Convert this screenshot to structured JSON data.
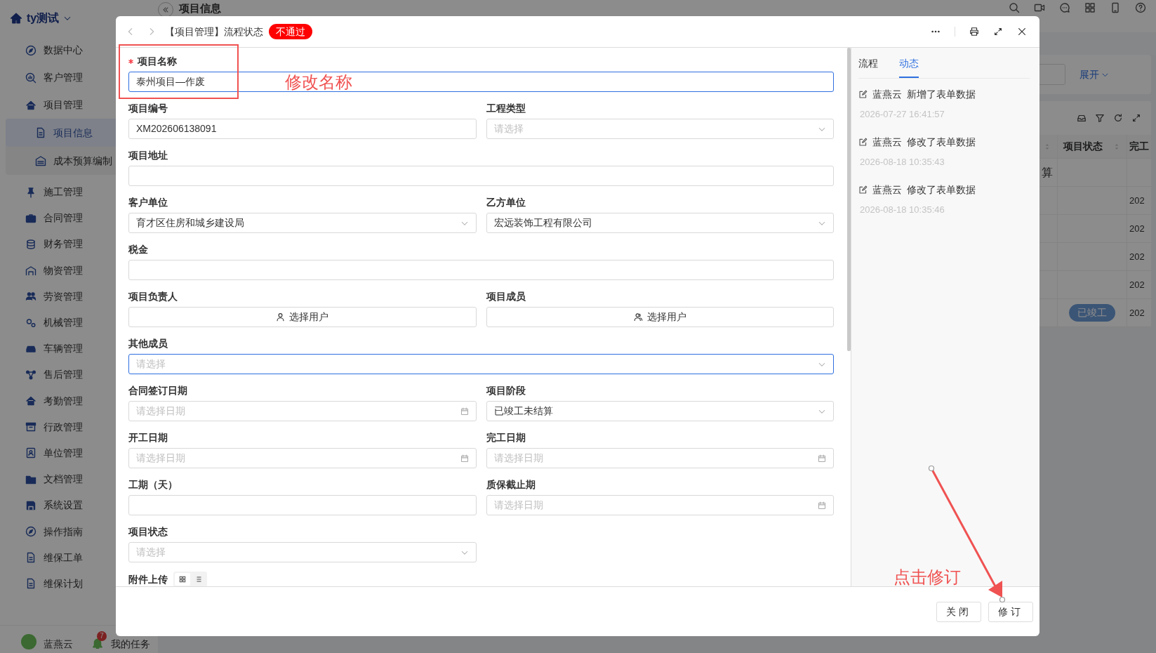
{
  "sidebar": {
    "brand": "ty测试",
    "items": [
      {
        "label": "数据中心",
        "selected": false
      },
      {
        "label": "客户管理",
        "selected": false
      },
      {
        "label": "项目管理",
        "selected": false,
        "children": [
          {
            "label": "项目信息",
            "selected": true
          },
          {
            "label": "成本预算编制",
            "selected": false
          }
        ]
      },
      {
        "label": "施工管理",
        "selected": false
      },
      {
        "label": "合同管理",
        "selected": false
      },
      {
        "label": "财务管理",
        "selected": false
      },
      {
        "label": "物资管理",
        "selected": false
      },
      {
        "label": "劳资管理",
        "selected": false
      },
      {
        "label": "机械管理",
        "selected": false
      },
      {
        "label": "车辆管理",
        "selected": false
      },
      {
        "label": "售后管理",
        "selected": false
      },
      {
        "label": "考勤管理",
        "selected": false
      },
      {
        "label": "行政管理",
        "selected": false
      },
      {
        "label": "单位管理",
        "selected": false
      },
      {
        "label": "文档管理",
        "selected": false
      },
      {
        "label": "系统设置",
        "selected": false
      },
      {
        "label": "操作指南",
        "selected": false
      },
      {
        "label": "维保工单",
        "selected": false
      },
      {
        "label": "维保计划",
        "selected": false
      }
    ],
    "user": "蓝燕云",
    "notification_count": "7",
    "tasks_label": "我的任务"
  },
  "page": {
    "title": "项目信息",
    "expand_link": "展开",
    "table": {
      "columns": [
        "项目状态",
        "完工"
      ],
      "rows": [
        {
          "column_1": "算"
        },
        {
          "completion": "202"
        },
        {
          "completion": "202"
        },
        {
          "completion": "202"
        },
        {
          "completion": "202"
        },
        {
          "status": "已竣工",
          "completion": "202"
        }
      ]
    }
  },
  "dialog": {
    "title": "【项目管理】流程状态",
    "status_badge": "不通过",
    "form": {
      "rows": [
        {
          "kind": "wide",
          "fields": [
            {
              "label": "项目名称",
              "kind": "text",
              "value": "泰州项目—作废",
              "required": true,
              "focused": true
            }
          ]
        },
        {
          "kind": "pair",
          "fields": [
            {
              "label": "项目编号",
              "kind": "text",
              "value": "XM202606138091",
              "required": false,
              "focused": false
            },
            {
              "label": "工程类型",
              "kind": "select",
              "placeholder": "请选择",
              "required": false,
              "focused": false
            }
          ]
        },
        {
          "kind": "wide",
          "fields": [
            {
              "label": "项目地址",
              "kind": "text",
              "required": false,
              "focused": false
            }
          ]
        },
        {
          "kind": "pair",
          "fields": [
            {
              "label": "客户单位",
              "kind": "select",
              "value": "育才区住房和城乡建设局",
              "required": false,
              "focused": false
            },
            {
              "label": "乙方单位",
              "kind": "select",
              "value": "宏远装饰工程有限公司",
              "required": false,
              "focused": false
            }
          ]
        },
        {
          "kind": "wide",
          "fields": [
            {
              "label": "税金",
              "kind": "text",
              "required": false,
              "focused": false
            }
          ]
        },
        {
          "kind": "pair",
          "fields": [
            {
              "label": "项目负责人",
              "kind": "user",
              "value": "选择用户",
              "required": false,
              "focused": false
            },
            {
              "label": "项目成员",
              "kind": "users",
              "value": "选择用户",
              "required": false,
              "focused": false
            }
          ]
        },
        {
          "kind": "wide",
          "fields": [
            {
              "label": "其他成员",
              "kind": "select",
              "placeholder": "请选择",
              "required": false,
              "focused": true
            }
          ]
        },
        {
          "kind": "pair",
          "fields": [
            {
              "label": "合同签订日期",
              "kind": "date",
              "placeholder": "请选择日期",
              "required": false,
              "focused": false
            },
            {
              "label": "项目阶段",
              "kind": "select",
              "value": "已竣工未结算",
              "required": false,
              "focused": false
            }
          ]
        },
        {
          "kind": "pair",
          "fields": [
            {
              "label": "开工日期",
              "kind": "date",
              "placeholder": "请选择日期",
              "required": false,
              "focused": false
            },
            {
              "label": "完工日期",
              "kind": "date",
              "placeholder": "请选择日期",
              "required": false,
              "focused": false
            }
          ]
        },
        {
          "kind": "pair",
          "fields": [
            {
              "label": "工期（天）",
              "kind": "text",
              "required": false,
              "focused": false
            },
            {
              "label": "质保截止期",
              "kind": "date",
              "placeholder": "请选择日期",
              "required": false,
              "focused": false
            }
          ]
        },
        {
          "kind": "pair",
          "fields": [
            {
              "label": "项目状态",
              "kind": "select",
              "placeholder": "请选择",
              "required": false,
              "focused": false
            }
          ]
        }
      ],
      "attachments": {
        "label": "附件上传",
        "views": [
          {
            "kind": "grid",
            "selected": true
          },
          {
            "kind": "list",
            "selected": false
          }
        ]
      }
    },
    "side_panel": {
      "tabs": [
        {
          "label": "流程",
          "selected": false
        },
        {
          "label": "动态",
          "selected": true
        }
      ],
      "activities": [
        {
          "user": "蓝燕云",
          "action": "新增了表单数据",
          "time": "2026-07-27 16:41:57"
        },
        {
          "user": "蓝燕云",
          "action": "修改了表单数据",
          "time": "2026-08-18 10:35:43"
        },
        {
          "user": "蓝燕云",
          "action": "修改了表单数据",
          "time": "2026-08-18 10:35:46"
        }
      ]
    },
    "buttons": [
      "关闭",
      "修订"
    ]
  },
  "annotations": [
    {
      "kind": "boxed",
      "text": "修改名称"
    },
    {
      "kind": "arrow",
      "text": "点击修订"
    }
  ]
}
